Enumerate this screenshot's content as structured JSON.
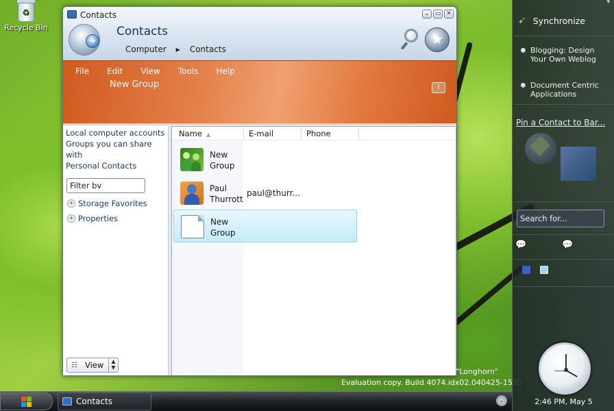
{
  "desktop": {
    "recycle_bin_label": "Recycle Bin",
    "watermark_longhorn": "e \"Longhorn\"",
    "watermark_build": "Evaluation copy. Build 4074.idx02.040425-1535"
  },
  "window": {
    "title": "Contacts",
    "heading": "Contacts",
    "breadcrumb": [
      "Computer",
      "Contacts"
    ],
    "controls": {
      "minimize": "⌄",
      "restore": "▭",
      "close": "✕"
    },
    "menu": [
      "File",
      "Edit",
      "View",
      "Tools",
      "Help"
    ],
    "task_header": "New Group",
    "left_pane": {
      "links": [
        "Local computer accounts",
        "Groups you can share with",
        "Personal Contacts"
      ],
      "filter_value": "Filter bv",
      "tree": [
        "Storage Favorites",
        "Properties"
      ],
      "view_button": "View"
    },
    "list": {
      "columns": [
        "Name",
        "E-mail",
        "Phone"
      ],
      "rows": [
        {
          "name": "New Group",
          "email": "",
          "icon": "group-icon"
        },
        {
          "name": "Paul Thurrott",
          "email": "paul@thurr...",
          "icon": "contact-icon"
        },
        {
          "name": "New Group",
          "email": "",
          "icon": "document-icon",
          "selected": true
        }
      ]
    }
  },
  "sidebar": {
    "sync_label": "Synchronize",
    "items": [
      "Blogging: Design Your Own Weblog",
      "Document Centric Applications"
    ],
    "pin_link": "Pin a Contact to Bar...",
    "search_placeholder": "Search for...",
    "clock_time": "2:46 PM, May 5"
  },
  "taskbar": {
    "task_label": "Contacts"
  },
  "colors": {
    "accent_orange": "#d8622a",
    "title_blue": "#1c3150",
    "selection": "#c4ebf8"
  }
}
